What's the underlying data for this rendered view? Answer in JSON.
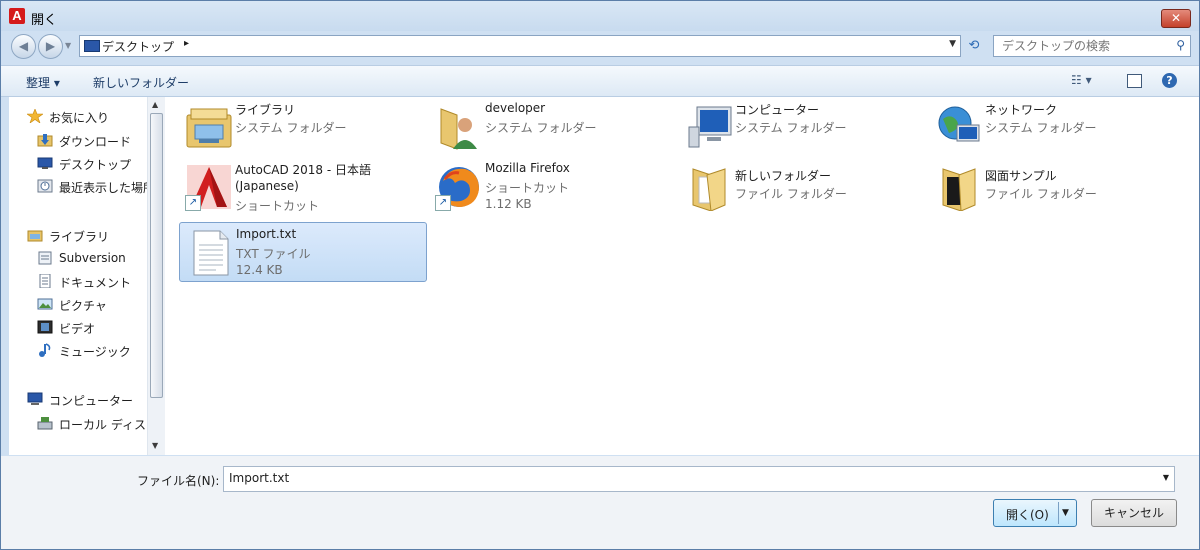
{
  "window": {
    "title": "開く",
    "app_icon_letter": "A",
    "close_symbol": "✕"
  },
  "address_bar": {
    "location": "デスクトップ",
    "breadcrumb_arrow": "▸",
    "search_placeholder": "デスクトップの検索"
  },
  "toolbar": {
    "organize": "整理 ▾",
    "new_folder": "新しいフォルダー",
    "help": "?"
  },
  "sidebar": {
    "favorites": [
      {
        "label": "お気に入り",
        "icon": "star-icon"
      },
      {
        "label": "ダウンロード",
        "icon": "download-folder-icon"
      },
      {
        "label": "デスクトップ",
        "icon": "desktop-icon"
      },
      {
        "label": "最近表示した場所",
        "icon": "recent-places-icon"
      }
    ],
    "libraries": [
      {
        "label": "ライブラリ",
        "icon": "library-icon"
      },
      {
        "label": "Subversion",
        "icon": "subversion-icon"
      },
      {
        "label": "ドキュメント",
        "icon": "documents-icon"
      },
      {
        "label": "ピクチャ",
        "icon": "pictures-icon"
      },
      {
        "label": "ビデオ",
        "icon": "videos-icon"
      },
      {
        "label": "ミュージック",
        "icon": "music-icon"
      }
    ],
    "computer": [
      {
        "label": "コンピューター",
        "icon": "computer-icon"
      },
      {
        "label": "ローカル ディスク",
        "icon": "local-disk-icon"
      }
    ]
  },
  "files": [
    {
      "name": "ライブラリ",
      "line2": "システム フォルダー",
      "line3": "",
      "icon": "library-folder-icon"
    },
    {
      "name": "developer",
      "line2": "システム フォルダー",
      "line3": "",
      "icon": "user-folder-icon"
    },
    {
      "name": "コンピューター",
      "line2": "システム フォルダー",
      "line3": "",
      "icon": "computer-icon"
    },
    {
      "name": "ネットワーク",
      "line2": "システム フォルダー",
      "line3": "",
      "icon": "network-icon"
    },
    {
      "name": "AutoCAD 2018 - 日本語",
      "line2": "(Japanese)",
      "line3": "ショートカット",
      "icon": "autocad-icon"
    },
    {
      "name": "Mozilla Firefox",
      "line2": "ショートカット",
      "line3": "1.12 KB",
      "icon": "firefox-icon"
    },
    {
      "name": "新しいフォルダー",
      "line2": "ファイル フォルダー",
      "line3": "",
      "icon": "folder-icon"
    },
    {
      "name": "図面サンプル",
      "line2": "ファイル フォルダー",
      "line3": "",
      "icon": "folder-icon"
    },
    {
      "name": "Import.txt",
      "line2": "TXT ファイル",
      "line3": "12.4 KB",
      "icon": "text-file-icon",
      "selected": true
    }
  ],
  "bottom": {
    "filename_label": "ファイル名(N):",
    "filename_value": "Import.txt",
    "open_label": "開く(O)",
    "cancel_label": "キャンセル"
  },
  "colors": {
    "accent": "#2e68b1",
    "selection": "#c3dcf5",
    "title_bar": "#d9e7f5"
  }
}
